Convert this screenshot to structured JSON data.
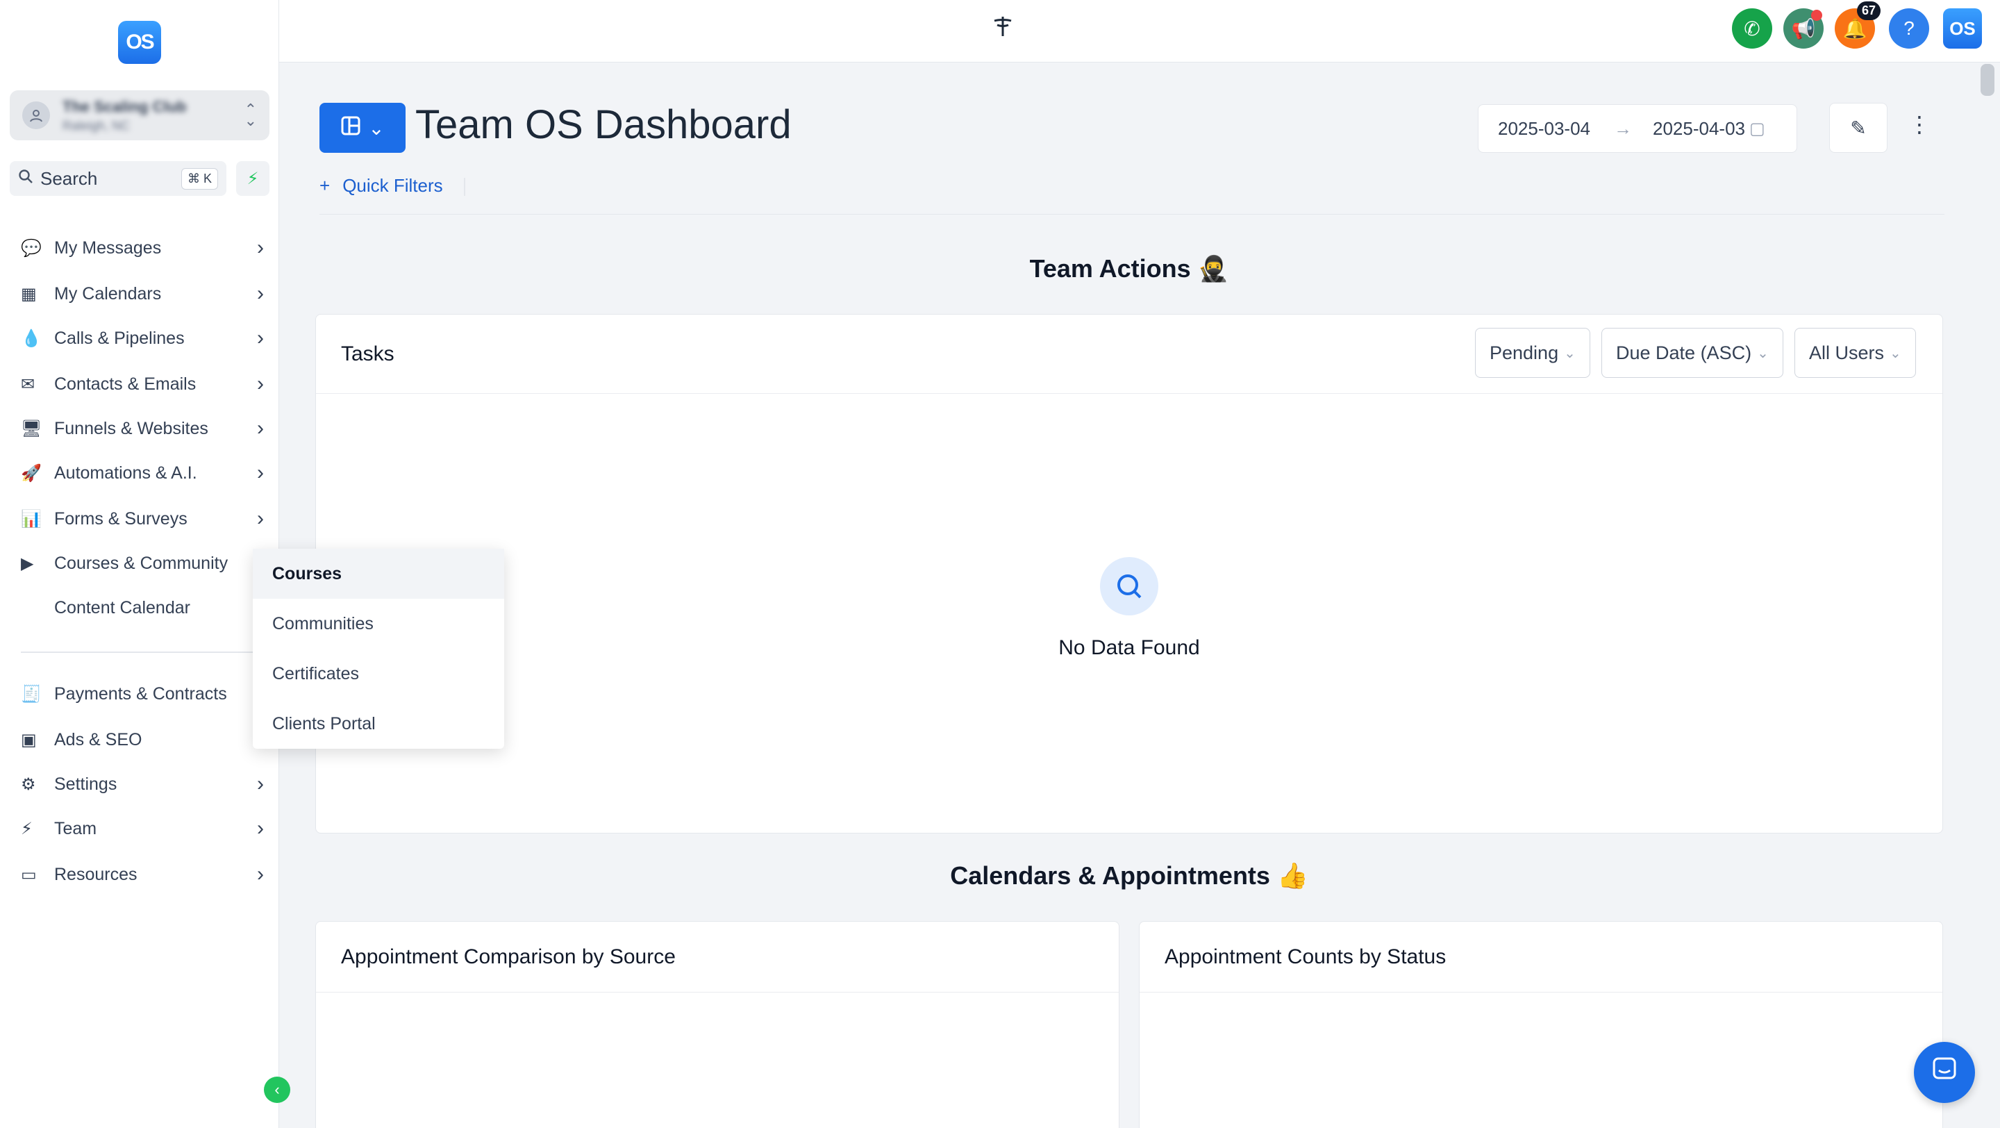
{
  "sidebar": {
    "logo_text": "OS",
    "account": {
      "name": "The Scaling Club",
      "location": "Raleigh, NC"
    },
    "search": {
      "placeholder": "Search",
      "shortcut": "⌘ K"
    },
    "items": [
      {
        "label": "My Messages",
        "icon": "chat-bubbles-icon"
      },
      {
        "label": "My Calendars",
        "icon": "calendar-icon"
      },
      {
        "label": "Calls & Pipelines",
        "icon": "funnel-drop-icon"
      },
      {
        "label": "Contacts & Emails",
        "icon": "envelope-icon"
      },
      {
        "label": "Funnels & Websites",
        "icon": "monitor-icon"
      },
      {
        "label": "Automations & A.I.",
        "icon": "rocket-icon"
      },
      {
        "label": "Forms & Surveys",
        "icon": "bar-chart-icon"
      },
      {
        "label": "Courses & Community",
        "icon": "play-icon"
      },
      {
        "label": "Content Calendar",
        "icon": "apple-icon"
      },
      {
        "label": "Payments & Contracts",
        "icon": "invoice-icon"
      },
      {
        "label": "Ads & SEO",
        "icon": "ad-icon"
      },
      {
        "label": "Settings",
        "icon": "gear-icon"
      },
      {
        "label": "Team",
        "icon": "bolt-icon"
      },
      {
        "label": "Resources",
        "icon": "battery-icon"
      }
    ]
  },
  "submenu": {
    "items": [
      "Courses",
      "Communities",
      "Certificates",
      "Clients Portal"
    ]
  },
  "topbar": {
    "notification_count": "67",
    "help_label": "?",
    "logo_text": "OS"
  },
  "header": {
    "title": "Team OS Dashboard",
    "date_start": "2025-03-04",
    "date_end": "2025-04-03",
    "quick_filters_label": "Quick Filters"
  },
  "team_actions": {
    "title": "Team Actions 🥷",
    "card_title": "Tasks",
    "filters": [
      "Pending",
      "Due Date (ASC)",
      "All Users"
    ],
    "empty_text": "No Data Found"
  },
  "calendars": {
    "title": "Calendars & Appointments 👍",
    "card1_title": "Appointment Comparison by Source",
    "card2_title": "Appointment Counts by Status"
  },
  "colors": {
    "primary": "#1c6ee8",
    "phone": "#16a34a",
    "announce": "#3f8f6f",
    "bell": "#f97316",
    "help": "#2f80ed",
    "accent_green": "#22c55e"
  }
}
